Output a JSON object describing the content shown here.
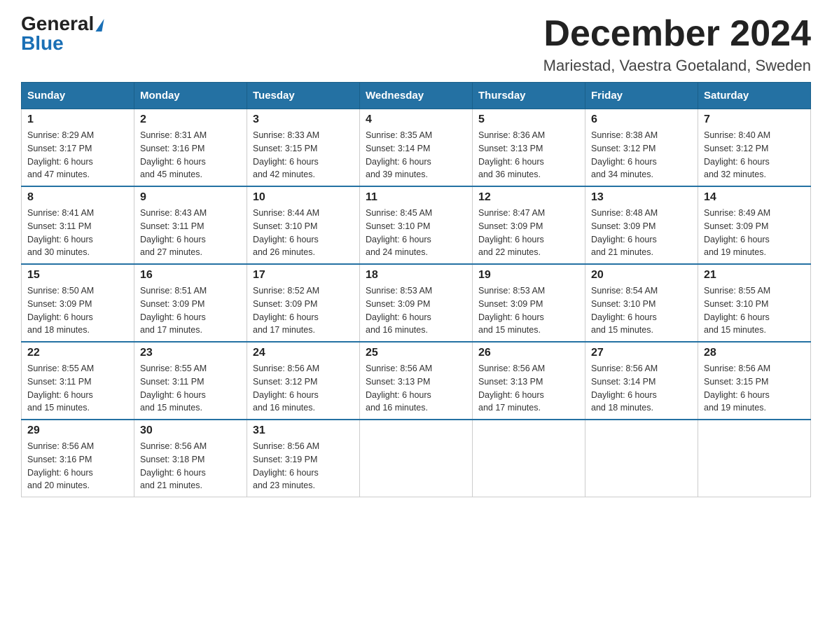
{
  "header": {
    "logo_general": "General",
    "logo_blue": "Blue",
    "month_title": "December 2024",
    "location": "Mariestad, Vaestra Goetaland, Sweden"
  },
  "weekdays": [
    "Sunday",
    "Monday",
    "Tuesday",
    "Wednesday",
    "Thursday",
    "Friday",
    "Saturday"
  ],
  "weeks": [
    [
      {
        "day": "1",
        "sunrise": "8:29 AM",
        "sunset": "3:17 PM",
        "daylight": "6 hours and 47 minutes."
      },
      {
        "day": "2",
        "sunrise": "8:31 AM",
        "sunset": "3:16 PM",
        "daylight": "6 hours and 45 minutes."
      },
      {
        "day": "3",
        "sunrise": "8:33 AM",
        "sunset": "3:15 PM",
        "daylight": "6 hours and 42 minutes."
      },
      {
        "day": "4",
        "sunrise": "8:35 AM",
        "sunset": "3:14 PM",
        "daylight": "6 hours and 39 minutes."
      },
      {
        "day": "5",
        "sunrise": "8:36 AM",
        "sunset": "3:13 PM",
        "daylight": "6 hours and 36 minutes."
      },
      {
        "day": "6",
        "sunrise": "8:38 AM",
        "sunset": "3:12 PM",
        "daylight": "6 hours and 34 minutes."
      },
      {
        "day": "7",
        "sunrise": "8:40 AM",
        "sunset": "3:12 PM",
        "daylight": "6 hours and 32 minutes."
      }
    ],
    [
      {
        "day": "8",
        "sunrise": "8:41 AM",
        "sunset": "3:11 PM",
        "daylight": "6 hours and 30 minutes."
      },
      {
        "day": "9",
        "sunrise": "8:43 AM",
        "sunset": "3:11 PM",
        "daylight": "6 hours and 27 minutes."
      },
      {
        "day": "10",
        "sunrise": "8:44 AM",
        "sunset": "3:10 PM",
        "daylight": "6 hours and 26 minutes."
      },
      {
        "day": "11",
        "sunrise": "8:45 AM",
        "sunset": "3:10 PM",
        "daylight": "6 hours and 24 minutes."
      },
      {
        "day": "12",
        "sunrise": "8:47 AM",
        "sunset": "3:09 PM",
        "daylight": "6 hours and 22 minutes."
      },
      {
        "day": "13",
        "sunrise": "8:48 AM",
        "sunset": "3:09 PM",
        "daylight": "6 hours and 21 minutes."
      },
      {
        "day": "14",
        "sunrise": "8:49 AM",
        "sunset": "3:09 PM",
        "daylight": "6 hours and 19 minutes."
      }
    ],
    [
      {
        "day": "15",
        "sunrise": "8:50 AM",
        "sunset": "3:09 PM",
        "daylight": "6 hours and 18 minutes."
      },
      {
        "day": "16",
        "sunrise": "8:51 AM",
        "sunset": "3:09 PM",
        "daylight": "6 hours and 17 minutes."
      },
      {
        "day": "17",
        "sunrise": "8:52 AM",
        "sunset": "3:09 PM",
        "daylight": "6 hours and 17 minutes."
      },
      {
        "day": "18",
        "sunrise": "8:53 AM",
        "sunset": "3:09 PM",
        "daylight": "6 hours and 16 minutes."
      },
      {
        "day": "19",
        "sunrise": "8:53 AM",
        "sunset": "3:09 PM",
        "daylight": "6 hours and 15 minutes."
      },
      {
        "day": "20",
        "sunrise": "8:54 AM",
        "sunset": "3:10 PM",
        "daylight": "6 hours and 15 minutes."
      },
      {
        "day": "21",
        "sunrise": "8:55 AM",
        "sunset": "3:10 PM",
        "daylight": "6 hours and 15 minutes."
      }
    ],
    [
      {
        "day": "22",
        "sunrise": "8:55 AM",
        "sunset": "3:11 PM",
        "daylight": "6 hours and 15 minutes."
      },
      {
        "day": "23",
        "sunrise": "8:55 AM",
        "sunset": "3:11 PM",
        "daylight": "6 hours and 15 minutes."
      },
      {
        "day": "24",
        "sunrise": "8:56 AM",
        "sunset": "3:12 PM",
        "daylight": "6 hours and 16 minutes."
      },
      {
        "day": "25",
        "sunrise": "8:56 AM",
        "sunset": "3:13 PM",
        "daylight": "6 hours and 16 minutes."
      },
      {
        "day": "26",
        "sunrise": "8:56 AM",
        "sunset": "3:13 PM",
        "daylight": "6 hours and 17 minutes."
      },
      {
        "day": "27",
        "sunrise": "8:56 AM",
        "sunset": "3:14 PM",
        "daylight": "6 hours and 18 minutes."
      },
      {
        "day": "28",
        "sunrise": "8:56 AM",
        "sunset": "3:15 PM",
        "daylight": "6 hours and 19 minutes."
      }
    ],
    [
      {
        "day": "29",
        "sunrise": "8:56 AM",
        "sunset": "3:16 PM",
        "daylight": "6 hours and 20 minutes."
      },
      {
        "day": "30",
        "sunrise": "8:56 AM",
        "sunset": "3:18 PM",
        "daylight": "6 hours and 21 minutes."
      },
      {
        "day": "31",
        "sunrise": "8:56 AM",
        "sunset": "3:19 PM",
        "daylight": "6 hours and 23 minutes."
      },
      null,
      null,
      null,
      null
    ]
  ]
}
